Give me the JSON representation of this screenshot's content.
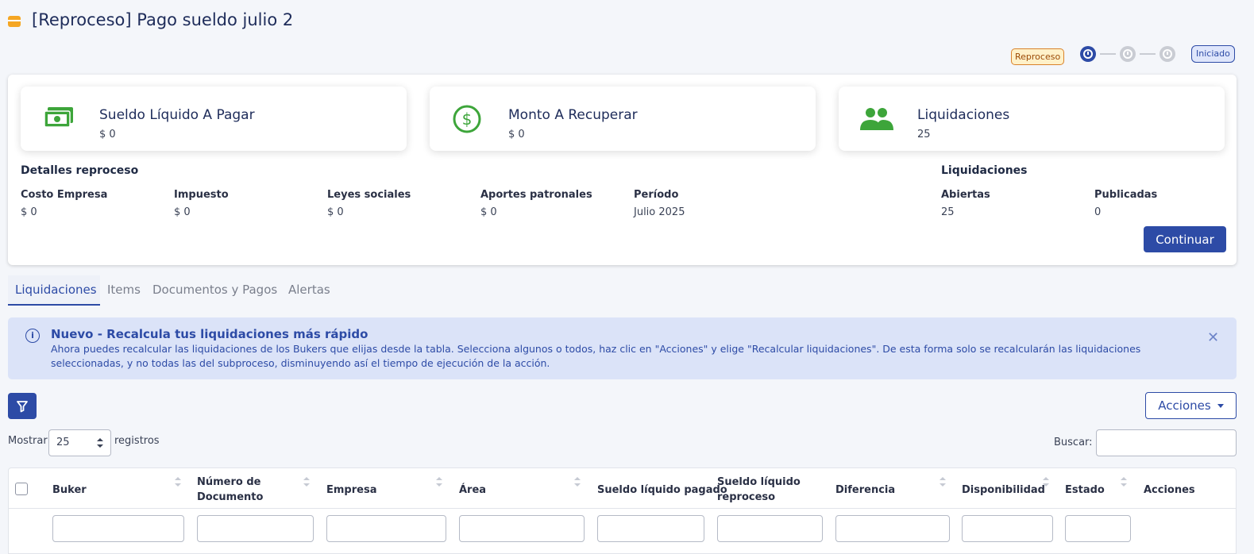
{
  "header": {
    "title": "[Reproceso] Pago sueldo julio 2",
    "badge_type": "Reproceso",
    "status_badge": "Iniciado"
  },
  "kpis": [
    {
      "title": "Sueldo Líquido A Pagar",
      "value": "$ 0",
      "icon": "money-bill-icon"
    },
    {
      "title": "Monto A Recuperar",
      "value": "$ 0",
      "icon": "dollar-circle-icon"
    },
    {
      "title": "Liquidaciones",
      "value": "25",
      "icon": "users-icon"
    }
  ],
  "details": {
    "heading": "Detalles reproceso",
    "items": [
      {
        "label": "Costo Empresa",
        "value": "$ 0"
      },
      {
        "label": "Impuesto",
        "value": "$ 0"
      },
      {
        "label": "Leyes sociales",
        "value": "$ 0"
      },
      {
        "label": "Aportes patronales",
        "value": "$ 0"
      },
      {
        "label": "Período",
        "value": "Julio 2025"
      }
    ]
  },
  "liquidaciones_summary": {
    "heading": "Liquidaciones",
    "items": [
      {
        "label": "Abiertas",
        "value": "25"
      },
      {
        "label": "Publicadas",
        "value": "0"
      }
    ]
  },
  "continue_label": "Continuar",
  "tabs": [
    {
      "label": "Liquidaciones",
      "active": true
    },
    {
      "label": "Items",
      "active": false
    },
    {
      "label": "Documentos y Pagos",
      "active": false
    },
    {
      "label": "Alertas",
      "active": false
    }
  ],
  "alert": {
    "title": "Nuevo - Recalcula tus liquidaciones más rápido",
    "body": "Ahora puedes recalcular las liquidaciones de los Bukers que elijas desde la tabla. Selecciona algunos o todos, haz clic en \"Acciones\" y elige \"Recalcular liquidaciones\". De esta forma solo se recalcularán las liquidaciones seleccionadas, y no todas las del subproceso, disminuyendo así el tiempo de ejecución de la acción."
  },
  "toolbar": {
    "acciones_label": "Acciones",
    "show_label": "Mostrar",
    "page_size": "25",
    "records_label": "registros",
    "search_label": "Buscar:"
  },
  "table": {
    "columns": [
      "Buker",
      "Número de Documento",
      "Empresa",
      "Área",
      "Sueldo líquido pagado",
      "Sueldo líquido reproceso",
      "Diferencia",
      "Disponibilidad",
      "Estado",
      "Acciones"
    ]
  },
  "colors": {
    "primary": "#2d4ba6",
    "accent_icon": "#3da53a",
    "title_icon": "#f5a623"
  }
}
